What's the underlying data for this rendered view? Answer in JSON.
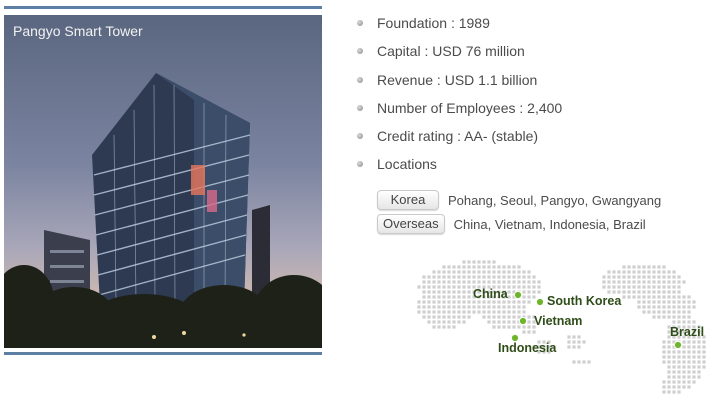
{
  "photo": {
    "caption": "Pangyo Smart Tower"
  },
  "facts": [
    {
      "text": "Foundation : 1989"
    },
    {
      "text": "Capital : USD 76 million"
    },
    {
      "text": "Revenue : USD 1.1 billion"
    },
    {
      "text": "Number of Employees : 2,400"
    },
    {
      "text": "Credit rating : AA- (stable)"
    },
    {
      "text": "Locations"
    }
  ],
  "locations": {
    "korea": {
      "tag": "Korea",
      "cities": "Pohang, Seoul, Pangyo, Gwangyang"
    },
    "overseas": {
      "tag": "Overseas",
      "countries": "China, Vietnam, Indonesia, Brazil"
    }
  },
  "map": {
    "markers": [
      {
        "label": "China"
      },
      {
        "label": "South Korea"
      },
      {
        "label": "Vietnam"
      },
      {
        "label": "Indonesia"
      },
      {
        "label": "Brazil"
      }
    ],
    "colors": {
      "dots": "#cfcfcf",
      "marker": "#6fb52c",
      "label": "#2f4d18"
    }
  }
}
